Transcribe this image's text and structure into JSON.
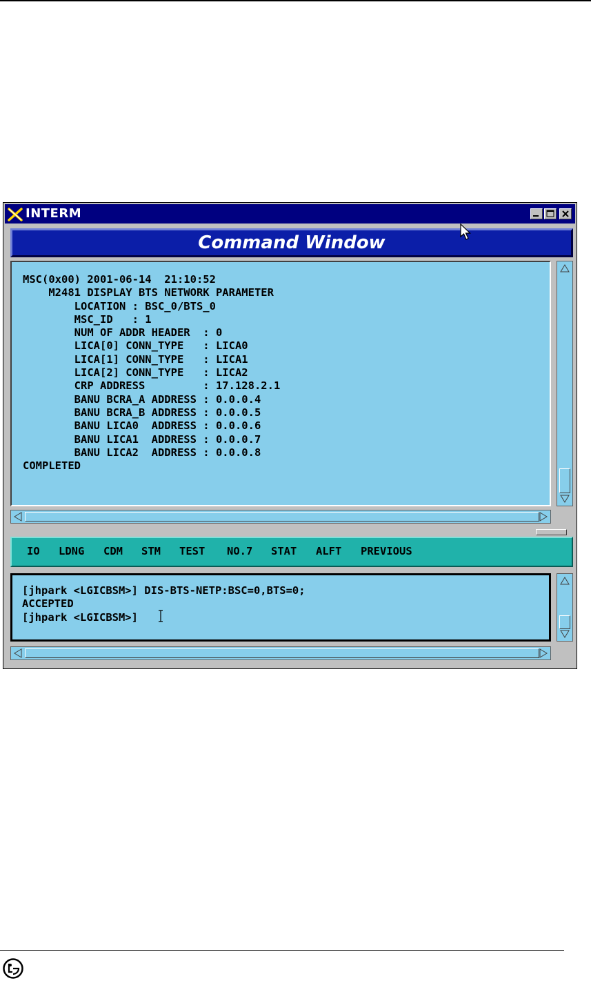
{
  "window": {
    "title": "INTERM",
    "banner": "Command Window",
    "controls": [
      "minimize-icon",
      "maximize-icon",
      "close-icon"
    ]
  },
  "output": {
    "lines": [
      "MSC(0x00) 2001-06-14  21:10:52",
      "    M2481 DISPLAY BTS NETWORK PARAMETER",
      "        LOCATION : BSC_0/BTS_0",
      "        MSC_ID   : 1",
      "        NUM OF ADDR HEADER  : 0",
      "        LICA[0] CONN_TYPE   : LICA0",
      "        LICA[1] CONN_TYPE   : LICA1",
      "        LICA[2] CONN_TYPE   : LICA2",
      "        CRP ADDRESS         : 17.128.2.1",
      "        BANU BCRA_A ADDRESS : 0.0.0.4",
      "        BANU BCRA_B ADDRESS : 0.0.0.5",
      "        BANU LICA0  ADDRESS : 0.0.0.6",
      "        BANU LICA1  ADDRESS : 0.0.0.7",
      "        BANU LICA2  ADDRESS : 0.0.0.8",
      "COMPLETED"
    ]
  },
  "menu": {
    "items": [
      "IO",
      "LDNG",
      "CDM",
      "STM",
      "TEST",
      "NO.7",
      "STAT",
      "ALFT",
      "PREVIOUS"
    ]
  },
  "input": {
    "lines": [
      "[jhpark <LGICBSM>] DIS-BTS-NETP:BSC=0,BTS=0;",
      "ACCEPTED",
      "[jhpark <LGICBSM>]"
    ]
  },
  "colors": {
    "titlebar": "#000080",
    "banner": "#0b1ea8",
    "panel": "#87ceeb",
    "menu": "#20b2aa",
    "chrome": "#c0c0c0"
  }
}
